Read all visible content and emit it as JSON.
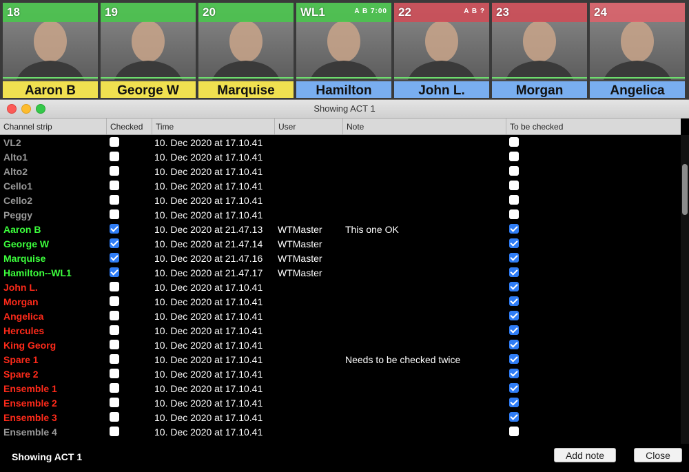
{
  "strips": [
    {
      "number": "18",
      "name": "Aaron B",
      "top_color": "#47c94a",
      "name_bg": "#f0e050",
      "meta": ""
    },
    {
      "number": "19",
      "name": "George W",
      "top_color": "#47c94a",
      "name_bg": "#f0e050",
      "meta": ""
    },
    {
      "number": "20",
      "name": "Marquise",
      "top_color": "#47c94a",
      "name_bg": "#f0e050",
      "meta": ""
    },
    {
      "number": "WL1",
      "name": "Hamilton",
      "top_color": "#47c94a",
      "name_bg": "#79aef0",
      "meta": "A B 7:00"
    },
    {
      "number": "22",
      "name": "John L.",
      "top_color": "#d24a55",
      "name_bg": "#79aef0",
      "meta": "A B ?"
    },
    {
      "number": "23",
      "name": "Morgan",
      "top_color": "#d24a55",
      "name_bg": "#79aef0",
      "meta": ""
    },
    {
      "number": "24",
      "name": "Angelica",
      "top_color": "#e0606a",
      "name_bg": "#79aef0",
      "meta": ""
    }
  ],
  "window": {
    "title": "Showing ACT 1",
    "status": "Showing ACT 1",
    "add_note_label": "Add note",
    "close_label": "Close"
  },
  "columns": [
    "Channel strip",
    "Checked",
    "Time",
    "User",
    "Note",
    "To be checked"
  ],
  "colors": {
    "gray": "#9a9a9a",
    "green": "#3cff3c",
    "red": "#ff2a1a",
    "checkbox_blue": "#2f7df6"
  },
  "rows": [
    {
      "name": "VL2",
      "color": "gray",
      "checked": false,
      "time": "10. Dec 2020 at 17.10.41",
      "user": "",
      "note": "",
      "to_check": false
    },
    {
      "name": "Alto1",
      "color": "gray",
      "checked": false,
      "time": "10. Dec 2020 at 17.10.41",
      "user": "",
      "note": "",
      "to_check": false
    },
    {
      "name": "Alto2",
      "color": "gray",
      "checked": false,
      "time": "10. Dec 2020 at 17.10.41",
      "user": "",
      "note": "",
      "to_check": false
    },
    {
      "name": "Cello1",
      "color": "gray",
      "checked": false,
      "time": "10. Dec 2020 at 17.10.41",
      "user": "",
      "note": "",
      "to_check": false
    },
    {
      "name": "Cello2",
      "color": "gray",
      "checked": false,
      "time": "10. Dec 2020 at 17.10.41",
      "user": "",
      "note": "",
      "to_check": false
    },
    {
      "name": "Peggy",
      "color": "gray",
      "checked": false,
      "time": "10. Dec 2020 at 17.10.41",
      "user": "",
      "note": "",
      "to_check": false
    },
    {
      "name": "Aaron B",
      "color": "green",
      "checked": true,
      "time": "10. Dec 2020 at 21.47.13",
      "user": "WTMaster",
      "note": "This one OK",
      "to_check": true
    },
    {
      "name": "George W",
      "color": "green",
      "checked": true,
      "time": "10. Dec 2020 at 21.47.14",
      "user": "WTMaster",
      "note": "",
      "to_check": true
    },
    {
      "name": "Marquise",
      "color": "green",
      "checked": true,
      "time": "10. Dec 2020 at 21.47.16",
      "user": "WTMaster",
      "note": "",
      "to_check": true
    },
    {
      "name": "Hamilton--WL1",
      "color": "green",
      "checked": true,
      "time": "10. Dec 2020 at 21.47.17",
      "user": "WTMaster",
      "note": "",
      "to_check": true
    },
    {
      "name": "John L.",
      "color": "red",
      "checked": false,
      "time": "10. Dec 2020 at 17.10.41",
      "user": "",
      "note": "",
      "to_check": true
    },
    {
      "name": "Morgan",
      "color": "red",
      "checked": false,
      "time": "10. Dec 2020 at 17.10.41",
      "user": "",
      "note": "",
      "to_check": true
    },
    {
      "name": "Angelica",
      "color": "red",
      "checked": false,
      "time": "10. Dec 2020 at 17.10.41",
      "user": "",
      "note": "",
      "to_check": true
    },
    {
      "name": "Hercules",
      "color": "red",
      "checked": false,
      "time": "10. Dec 2020 at 17.10.41",
      "user": "",
      "note": "",
      "to_check": true
    },
    {
      "name": "King Georg",
      "color": "red",
      "checked": false,
      "time": "10. Dec 2020 at 17.10.41",
      "user": "",
      "note": "",
      "to_check": true
    },
    {
      "name": "Spare 1",
      "color": "red",
      "checked": false,
      "time": "10. Dec 2020 at 17.10.41",
      "user": "",
      "note": "Needs to be checked twice",
      "to_check": true
    },
    {
      "name": "Spare 2",
      "color": "red",
      "checked": false,
      "time": "10. Dec 2020 at 17.10.41",
      "user": "",
      "note": "",
      "to_check": true
    },
    {
      "name": "Ensemble 1",
      "color": "red",
      "checked": false,
      "time": "10. Dec 2020 at 17.10.41",
      "user": "",
      "note": "",
      "to_check": true
    },
    {
      "name": "Ensemble 2",
      "color": "red",
      "checked": false,
      "time": "10. Dec 2020 at 17.10.41",
      "user": "",
      "note": "",
      "to_check": true
    },
    {
      "name": "Ensemble 3",
      "color": "red",
      "checked": false,
      "time": "10. Dec 2020 at 17.10.41",
      "user": "",
      "note": "",
      "to_check": true
    },
    {
      "name": "Ensemble 4",
      "color": "gray",
      "checked": false,
      "time": "10. Dec 2020 at 17.10.41",
      "user": "",
      "note": "",
      "to_check": false
    }
  ]
}
